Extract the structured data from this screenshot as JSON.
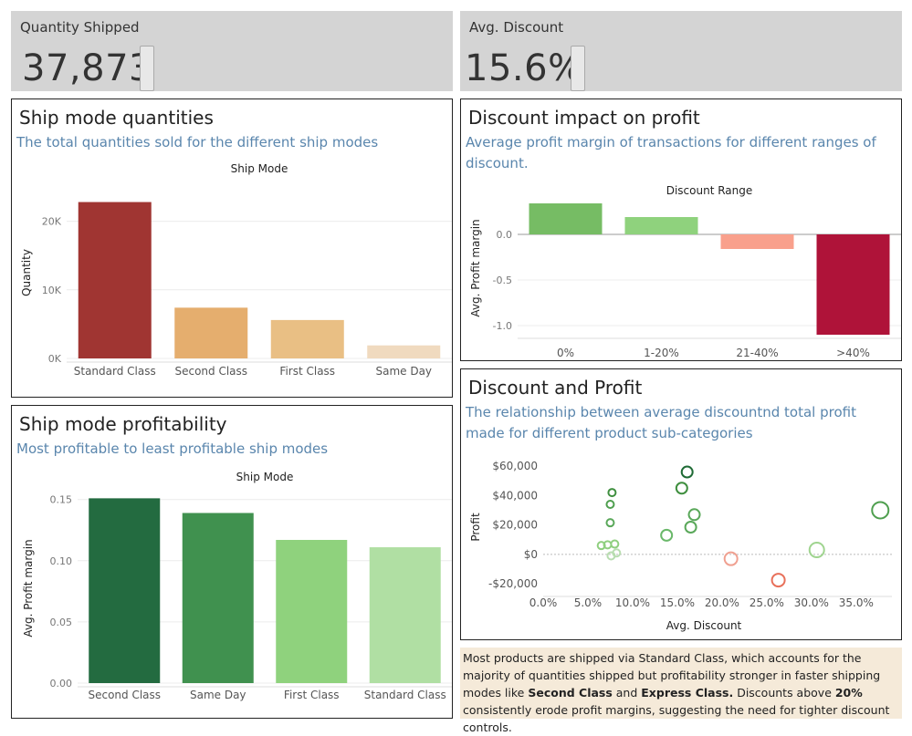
{
  "kpis": {
    "quantity": {
      "label": "Quantity Shipped",
      "value": "37,873"
    },
    "discount": {
      "label": "Avg. Discount",
      "value": "15.6%"
    }
  },
  "panels": {
    "ship_qty": {
      "title": "Ship mode quantities",
      "subtitle": "The total quantities sold for the different ship modes"
    },
    "discount_impact": {
      "title": "Discount impact on profit",
      "subtitle": "Average profit margin of transactions for different ranges of discount."
    },
    "ship_profit": {
      "title": "Ship mode profitability",
      "subtitle": "Most profitable to least profitable ship modes"
    },
    "discount_profit": {
      "title": "Discount and Profit",
      "subtitle": "The relationship between average discountnd total profit made for different product sub-categories"
    }
  },
  "note": {
    "part1": "Most products are shipped via Standard Class, which accounts for the majority of quantities shipped but profitability stronger in faster shipping modes like ",
    "bold1": "Second Class",
    "part2": " and ",
    "bold2": "Express Class.",
    "part3": " Discounts above ",
    "bold3": "20%",
    "part4": " consistently erode profit margins, suggesting the need for tighter discount controls."
  },
  "chart_data": [
    {
      "id": "ship_qty",
      "type": "bar",
      "header": "Ship Mode",
      "ylabel": "Quantity",
      "categories": [
        "Standard Class",
        "Second Class",
        "First Class",
        "Same Day"
      ],
      "values": [
        22800,
        7400,
        5600,
        1900
      ],
      "colors": [
        "#a03532",
        "#e5ae6e",
        "#e9bf84",
        "#f0dabf"
      ],
      "ylim": [
        0,
        25000
      ],
      "yticks": [
        {
          "v": 0,
          "label": "0K"
        },
        {
          "v": 10000,
          "label": "10K"
        },
        {
          "v": 20000,
          "label": "20K"
        }
      ]
    },
    {
      "id": "discount_impact",
      "type": "bar",
      "header": "Discount Range",
      "ylabel": "Avg. Profit margin",
      "categories": [
        "0%",
        "1-20%",
        "21-40%",
        ">40%"
      ],
      "values": [
        0.34,
        0.19,
        -0.16,
        -1.1
      ],
      "colors": [
        "#76bc64",
        "#8fd27d",
        "#f9a08c",
        "#af1339"
      ],
      "ylim": [
        -1.1,
        0.36
      ],
      "yticks": [
        {
          "v": 0,
          "label": "0.0"
        },
        {
          "v": -0.5,
          "label": "-0.5"
        },
        {
          "v": -1,
          "label": "-1.0"
        }
      ]
    },
    {
      "id": "ship_profit",
      "type": "bar",
      "header": "Ship Mode",
      "ylabel": "Avg. Profit margin",
      "categories": [
        "Second Class",
        "Same Day",
        "First Class",
        "Standard Class"
      ],
      "values": [
        0.151,
        0.139,
        0.117,
        0.111
      ],
      "colors": [
        "#236b40",
        "#40914f",
        "#8fd27d",
        "#b0dfa3"
      ],
      "ylim": [
        0,
        0.155
      ],
      "yticks": [
        {
          "v": 0,
          "label": "0.00"
        },
        {
          "v": 0.05,
          "label": "0.05"
        },
        {
          "v": 0.1,
          "label": "0.10"
        },
        {
          "v": 0.15,
          "label": "0.15"
        }
      ]
    },
    {
      "id": "discount_profit",
      "type": "scatter",
      "xlabel": "Avg. Discount",
      "ylabel": "Profit",
      "xlim": [
        0,
        0.39
      ],
      "ylim": [
        -28000,
        65000
      ],
      "xticks": [
        {
          "v": 0,
          "label": "0.0%"
        },
        {
          "v": 0.05,
          "label": "5.0%"
        },
        {
          "v": 0.1,
          "label": "10.0%"
        },
        {
          "v": 0.15,
          "label": "15.0%"
        },
        {
          "v": 0.2,
          "label": "20.0%"
        },
        {
          "v": 0.25,
          "label": "25.0%"
        },
        {
          "v": 0.3,
          "label": "30.0%"
        },
        {
          "v": 0.35,
          "label": "35.0%"
        }
      ],
      "yticks": [
        {
          "v": 60000,
          "label": "$60,000"
        },
        {
          "v": 40000,
          "label": "$40,000"
        },
        {
          "v": 20000,
          "label": "$20,000"
        },
        {
          "v": 0,
          "label": "$0"
        },
        {
          "v": -20000,
          "label": "-$20,000"
        }
      ],
      "points": [
        {
          "x": 0.161,
          "y": 56000,
          "size": 6,
          "color": "#1f6b35"
        },
        {
          "x": 0.077,
          "y": 42000,
          "size": 4,
          "color": "#3f8f3f"
        },
        {
          "x": 0.155,
          "y": 45000,
          "size": 6,
          "color": "#3f8f3f"
        },
        {
          "x": 0.075,
          "y": 34000,
          "size": 4,
          "color": "#4f9f4f"
        },
        {
          "x": 0.169,
          "y": 27000,
          "size": 6,
          "color": "#5aa85a"
        },
        {
          "x": 0.075,
          "y": 21500,
          "size": 4,
          "color": "#5aa85a"
        },
        {
          "x": 0.165,
          "y": 18500,
          "size": 6,
          "color": "#5aa85a"
        },
        {
          "x": 0.138,
          "y": 13000,
          "size": 6,
          "color": "#6ab86a"
        },
        {
          "x": 0.377,
          "y": 30000,
          "size": 9,
          "color": "#4f9f4f"
        },
        {
          "x": 0.065,
          "y": 6000,
          "size": 4,
          "color": "#8fcf7f"
        },
        {
          "x": 0.072,
          "y": 6500,
          "size": 4,
          "color": "#8fcf7f"
        },
        {
          "x": 0.08,
          "y": 7000,
          "size": 4,
          "color": "#8fcf7f"
        },
        {
          "x": 0.082,
          "y": 1000,
          "size": 4,
          "color": "#b8ddb0"
        },
        {
          "x": 0.076,
          "y": -1000,
          "size": 4,
          "color": "#b8ddb0"
        },
        {
          "x": 0.306,
          "y": 3000,
          "size": 8,
          "color": "#9fd48f"
        },
        {
          "x": 0.21,
          "y": -3000,
          "size": 7,
          "color": "#f0a090"
        },
        {
          "x": 0.263,
          "y": -17500,
          "size": 7,
          "color": "#e8705a"
        }
      ]
    }
  ]
}
